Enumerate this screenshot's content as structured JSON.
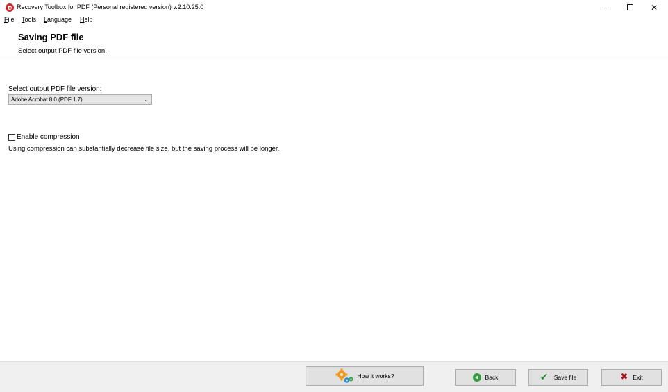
{
  "window": {
    "title": "Recovery Toolbox for PDF (Personal registered version) v.2.10.25.0",
    "minimize_glyph": "—",
    "close_glyph": "✕"
  },
  "menu": {
    "items": [
      {
        "underline": "F",
        "rest": "ile"
      },
      {
        "underline": "T",
        "rest": "ools"
      },
      {
        "underline": "L",
        "rest": "anguage"
      },
      {
        "underline": "H",
        "rest": "elp"
      }
    ]
  },
  "header": {
    "title": "Saving PDF file",
    "subtitle": "Select output PDF file version."
  },
  "form": {
    "version_label": "Select output PDF file version:",
    "version_selected": "Adobe Acrobat 8.0 (PDF 1.7)",
    "compression_label": "Enable compression",
    "compression_checked": false,
    "compression_note": "Using compression can substantially decrease file size, but the saving process will be longer."
  },
  "footer": {
    "how_label": "How it works?",
    "back_label": "Back",
    "save_label": "Save file",
    "exit_label": "Exit",
    "check_glyph": "✔",
    "x_glyph": "✖"
  },
  "icons": {
    "app": "recovery-toolbox-logo",
    "how": "gears-icon",
    "back": "back-arrow-icon",
    "save": "checkmark-icon",
    "exit": "x-icon"
  },
  "colors": {
    "app_icon": "#d2262c",
    "back_icon": "#2e9e3a",
    "save_icon": "#1f8b2a",
    "exit_icon": "#b01010",
    "gear_orange": "#f09a1a",
    "gear_blue": "#2a8fd8",
    "gear_green": "#37a84a"
  }
}
